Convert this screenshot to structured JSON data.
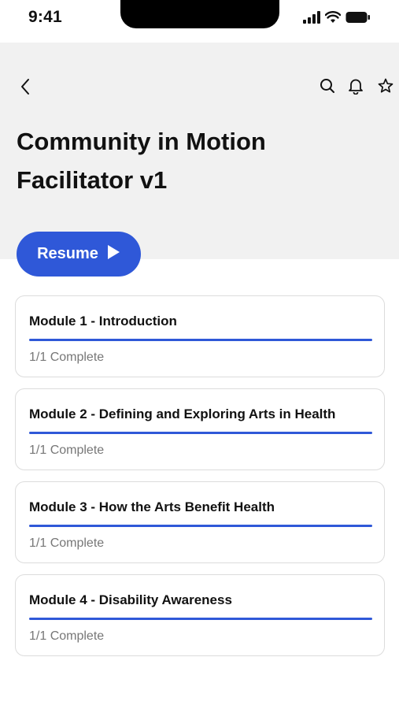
{
  "status_bar": {
    "time": "9:41",
    "icons": [
      "signal-icon",
      "wifi-icon",
      "battery-icon"
    ]
  },
  "header": {
    "back_icon": "chevron-left-icon",
    "actions": [
      "search-icon",
      "bell-icon",
      "star-icon"
    ],
    "title": "Community in Motion Facilitator v1"
  },
  "resume": {
    "label": "Resume",
    "icon": "play-icon"
  },
  "modules": [
    {
      "title": "Module 1 - Introduction",
      "status": "1/1 Complete",
      "progress": 1.0
    },
    {
      "title": "Module 2 - Defining and Exploring Arts in Health",
      "status": "1/1 Complete",
      "progress": 1.0
    },
    {
      "title": "Module 3 - How the Arts Benefit Health",
      "status": "1/1 Complete",
      "progress": 1.0
    },
    {
      "title": "Module 4 - Disability Awareness",
      "status": "1/1 Complete",
      "progress": 1.0
    }
  ],
  "colors": {
    "accent": "#2f58d8",
    "header_bg": "#f1f1f1",
    "card_border": "#dcdcdc",
    "muted_text": "#777777"
  }
}
